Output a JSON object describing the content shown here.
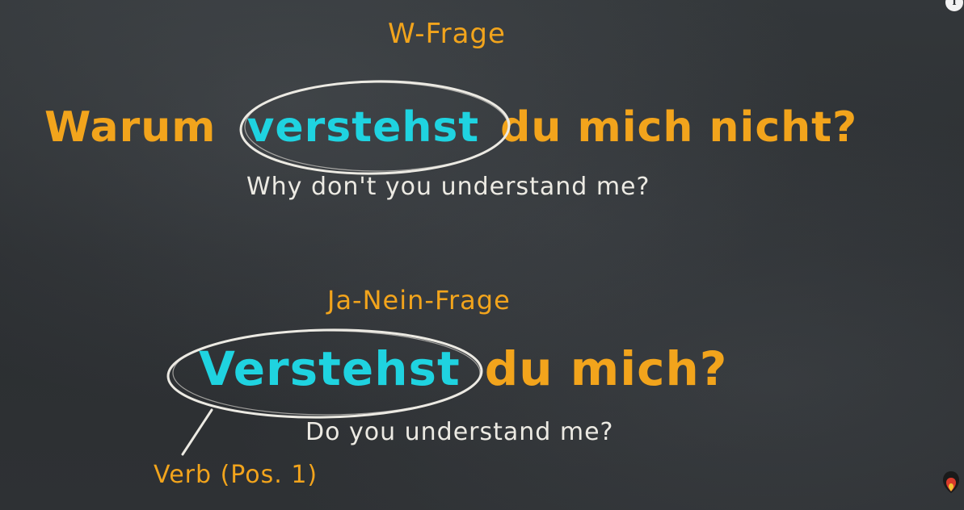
{
  "board": {
    "w_question_heading": "W-Frage",
    "w_question": {
      "word1": "Warum",
      "verb": "verstehst",
      "rest": "du mich nicht?"
    },
    "w_translation": "Why don't you understand me?",
    "yes_no_heading": "Ja-Nein-Frage",
    "yes_no_question": {
      "verb": "Verstehst",
      "rest": "du mich?"
    },
    "yes_no_translation": "Do you understand me?",
    "verb_annotation": "Verb (Pos. 1)"
  },
  "colors": {
    "chalkboard": "#2f3235",
    "orange_chalk": "#f2a41c",
    "cyan_chalk": "#1fd3e0",
    "white_chalk": "#eceae3"
  },
  "icons": {
    "info": "info-icon",
    "logo": "channel-logo-icon"
  }
}
